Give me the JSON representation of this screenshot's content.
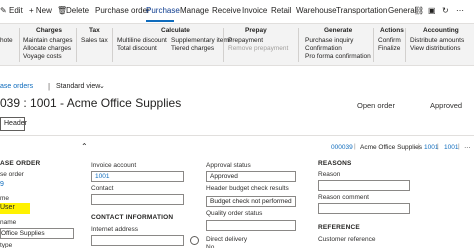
{
  "actionbar": {
    "items": [
      "Edit",
      "+ New",
      "Delete",
      "Purchase order",
      "Purchase",
      "Manage",
      "Receive",
      "Invoice",
      "Retail",
      "Warehouse",
      "Transportation",
      "General"
    ]
  },
  "ribbon": {
    "groups": {
      "partial": {
        "items": [
          "hote"
        ]
      },
      "charges": {
        "title": "Charges",
        "items": [
          "Maintain charges",
          "Allocate charges",
          "Voyage costs"
        ]
      },
      "tax": {
        "title": "Tax",
        "items": [
          "Sales tax"
        ]
      },
      "calculate": {
        "title": "Calculate",
        "items": [
          "Multiline discount",
          "Total discount",
          "Supplementary items",
          "Tiered charges"
        ]
      },
      "prepay": {
        "title": "Prepay",
        "items": [
          "Prepayment",
          "Remove prepayment"
        ]
      },
      "generate": {
        "title": "Generate",
        "items": [
          "Purchase inquiry",
          "Confirmation",
          "Pro forma confirmation"
        ]
      },
      "actions": {
        "title": "Actions",
        "items": [
          "Confirm",
          "Finalize"
        ]
      },
      "accounting": {
        "title": "Accounting",
        "items": [
          "Distribute amounts",
          "View distributions"
        ]
      }
    }
  },
  "breadcrumb": {
    "link": "ase orders",
    "view": "Standard view"
  },
  "header": {
    "title": "039 : 1001 - Acme Office Supplies",
    "status1": "Open order",
    "status2": "Approved"
  },
  "tabs": {
    "header": "Header"
  },
  "summary": {
    "order": "000039",
    "vendor": "Acme Office Supplies",
    "account": "1001",
    "second": "1001"
  },
  "columns": {
    "col1": {
      "section": "ASE ORDER",
      "order_label": "se order",
      "order_value": "9",
      "name_label": "me",
      "name_value": "User",
      "vname_label": "name",
      "vname_value": "Office Supplies",
      "type_label": "type"
    },
    "col2": {
      "invoice_label": "Invoice account",
      "invoice_value": "1001",
      "contact_label": "Contact",
      "section": "CONTACT INFORMATION",
      "internet_label": "Internet address"
    },
    "col3": {
      "approval_label": "Approval status",
      "approval_value": "Approved",
      "budget_label": "Header budget check results",
      "budget_value": "Budget check not performed",
      "quality_label": "Quality order status",
      "direct_label": "Direct delivery",
      "direct_value": "No"
    },
    "col4": {
      "section": "REASONS",
      "reason_label": "Reason",
      "reason_comment_label": "Reason comment",
      "ref_section": "REFERENCE",
      "ref_label": "Customer reference"
    }
  },
  "colors": {
    "accent": "#0f6cbd",
    "highlight": "#fff200"
  }
}
